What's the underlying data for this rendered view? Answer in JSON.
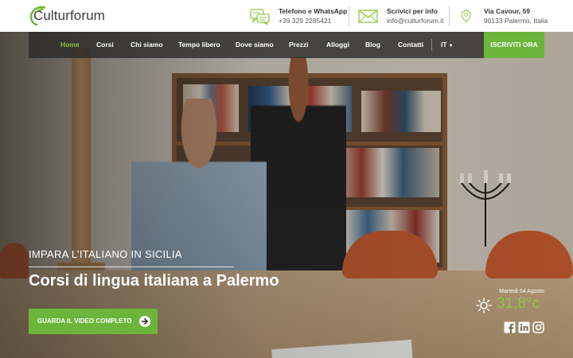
{
  "brand": {
    "name": "Culturforum",
    "accent": "#8dc63f",
    "cta_color": "#6bb53a"
  },
  "header": {
    "contacts": [
      {
        "icon": "chat-icon",
        "title": "Telefono e WhatsApp",
        "value": "+39 329 2285421"
      },
      {
        "icon": "mail-icon",
        "title": "Scrivici per info",
        "value": "info@culturforum.it"
      },
      {
        "icon": "location-pin-icon",
        "title": "Via Cavour, 59",
        "value": "90133 Palermo, Italia"
      }
    ]
  },
  "nav": {
    "items": [
      "Home",
      "Corsi",
      "Chi siamo",
      "Tempo libero",
      "Dove siamo",
      "Prezzi",
      "Alloggi",
      "Blog",
      "Contatti"
    ],
    "active": "Home",
    "language": "IT",
    "cta": "ISCRIVITI ORA"
  },
  "hero": {
    "subtitle": "IMPARA L’ITALIANO IN SICILIA",
    "title": "Corsi di lingua italiana a Palermo",
    "button": "GUARDA IL VIDEO COMPLETO"
  },
  "weather": {
    "date": "Martedì 04 Agosto",
    "temperature": "31,8°c",
    "icon": "sun-icon"
  },
  "social": [
    "facebook-icon",
    "linkedin-icon",
    "instagram-icon"
  ]
}
